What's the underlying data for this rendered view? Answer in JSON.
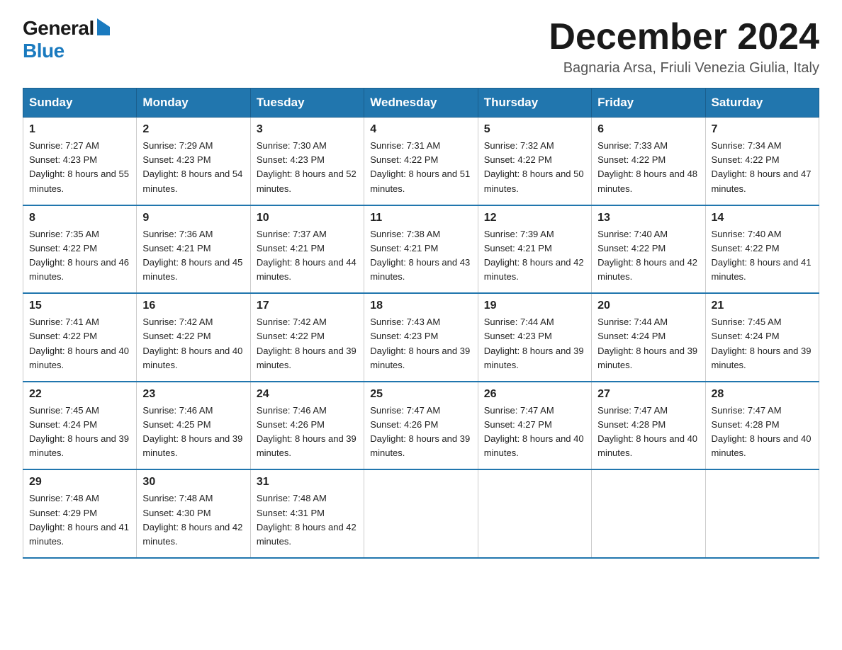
{
  "logo": {
    "general": "General",
    "blue": "Blue"
  },
  "header": {
    "month_year": "December 2024",
    "location": "Bagnaria Arsa, Friuli Venezia Giulia, Italy"
  },
  "weekdays": [
    "Sunday",
    "Monday",
    "Tuesday",
    "Wednesday",
    "Thursday",
    "Friday",
    "Saturday"
  ],
  "weeks": [
    [
      {
        "day": "1",
        "sunrise": "7:27 AM",
        "sunset": "4:23 PM",
        "daylight": "8 hours and 55 minutes."
      },
      {
        "day": "2",
        "sunrise": "7:29 AM",
        "sunset": "4:23 PM",
        "daylight": "8 hours and 54 minutes."
      },
      {
        "day": "3",
        "sunrise": "7:30 AM",
        "sunset": "4:23 PM",
        "daylight": "8 hours and 52 minutes."
      },
      {
        "day": "4",
        "sunrise": "7:31 AM",
        "sunset": "4:22 PM",
        "daylight": "8 hours and 51 minutes."
      },
      {
        "day": "5",
        "sunrise": "7:32 AM",
        "sunset": "4:22 PM",
        "daylight": "8 hours and 50 minutes."
      },
      {
        "day": "6",
        "sunrise": "7:33 AM",
        "sunset": "4:22 PM",
        "daylight": "8 hours and 48 minutes."
      },
      {
        "day": "7",
        "sunrise": "7:34 AM",
        "sunset": "4:22 PM",
        "daylight": "8 hours and 47 minutes."
      }
    ],
    [
      {
        "day": "8",
        "sunrise": "7:35 AM",
        "sunset": "4:22 PM",
        "daylight": "8 hours and 46 minutes."
      },
      {
        "day": "9",
        "sunrise": "7:36 AM",
        "sunset": "4:21 PM",
        "daylight": "8 hours and 45 minutes."
      },
      {
        "day": "10",
        "sunrise": "7:37 AM",
        "sunset": "4:21 PM",
        "daylight": "8 hours and 44 minutes."
      },
      {
        "day": "11",
        "sunrise": "7:38 AM",
        "sunset": "4:21 PM",
        "daylight": "8 hours and 43 minutes."
      },
      {
        "day": "12",
        "sunrise": "7:39 AM",
        "sunset": "4:21 PM",
        "daylight": "8 hours and 42 minutes."
      },
      {
        "day": "13",
        "sunrise": "7:40 AM",
        "sunset": "4:22 PM",
        "daylight": "8 hours and 42 minutes."
      },
      {
        "day": "14",
        "sunrise": "7:40 AM",
        "sunset": "4:22 PM",
        "daylight": "8 hours and 41 minutes."
      }
    ],
    [
      {
        "day": "15",
        "sunrise": "7:41 AM",
        "sunset": "4:22 PM",
        "daylight": "8 hours and 40 minutes."
      },
      {
        "day": "16",
        "sunrise": "7:42 AM",
        "sunset": "4:22 PM",
        "daylight": "8 hours and 40 minutes."
      },
      {
        "day": "17",
        "sunrise": "7:42 AM",
        "sunset": "4:22 PM",
        "daylight": "8 hours and 39 minutes."
      },
      {
        "day": "18",
        "sunrise": "7:43 AM",
        "sunset": "4:23 PM",
        "daylight": "8 hours and 39 minutes."
      },
      {
        "day": "19",
        "sunrise": "7:44 AM",
        "sunset": "4:23 PM",
        "daylight": "8 hours and 39 minutes."
      },
      {
        "day": "20",
        "sunrise": "7:44 AM",
        "sunset": "4:24 PM",
        "daylight": "8 hours and 39 minutes."
      },
      {
        "day": "21",
        "sunrise": "7:45 AM",
        "sunset": "4:24 PM",
        "daylight": "8 hours and 39 minutes."
      }
    ],
    [
      {
        "day": "22",
        "sunrise": "7:45 AM",
        "sunset": "4:24 PM",
        "daylight": "8 hours and 39 minutes."
      },
      {
        "day": "23",
        "sunrise": "7:46 AM",
        "sunset": "4:25 PM",
        "daylight": "8 hours and 39 minutes."
      },
      {
        "day": "24",
        "sunrise": "7:46 AM",
        "sunset": "4:26 PM",
        "daylight": "8 hours and 39 minutes."
      },
      {
        "day": "25",
        "sunrise": "7:47 AM",
        "sunset": "4:26 PM",
        "daylight": "8 hours and 39 minutes."
      },
      {
        "day": "26",
        "sunrise": "7:47 AM",
        "sunset": "4:27 PM",
        "daylight": "8 hours and 40 minutes."
      },
      {
        "day": "27",
        "sunrise": "7:47 AM",
        "sunset": "4:28 PM",
        "daylight": "8 hours and 40 minutes."
      },
      {
        "day": "28",
        "sunrise": "7:47 AM",
        "sunset": "4:28 PM",
        "daylight": "8 hours and 40 minutes."
      }
    ],
    [
      {
        "day": "29",
        "sunrise": "7:48 AM",
        "sunset": "4:29 PM",
        "daylight": "8 hours and 41 minutes."
      },
      {
        "day": "30",
        "sunrise": "7:48 AM",
        "sunset": "4:30 PM",
        "daylight": "8 hours and 42 minutes."
      },
      {
        "day": "31",
        "sunrise": "7:48 AM",
        "sunset": "4:31 PM",
        "daylight": "8 hours and 42 minutes."
      },
      null,
      null,
      null,
      null
    ]
  ],
  "labels": {
    "sunrise": "Sunrise:",
    "sunset": "Sunset:",
    "daylight": "Daylight:"
  }
}
